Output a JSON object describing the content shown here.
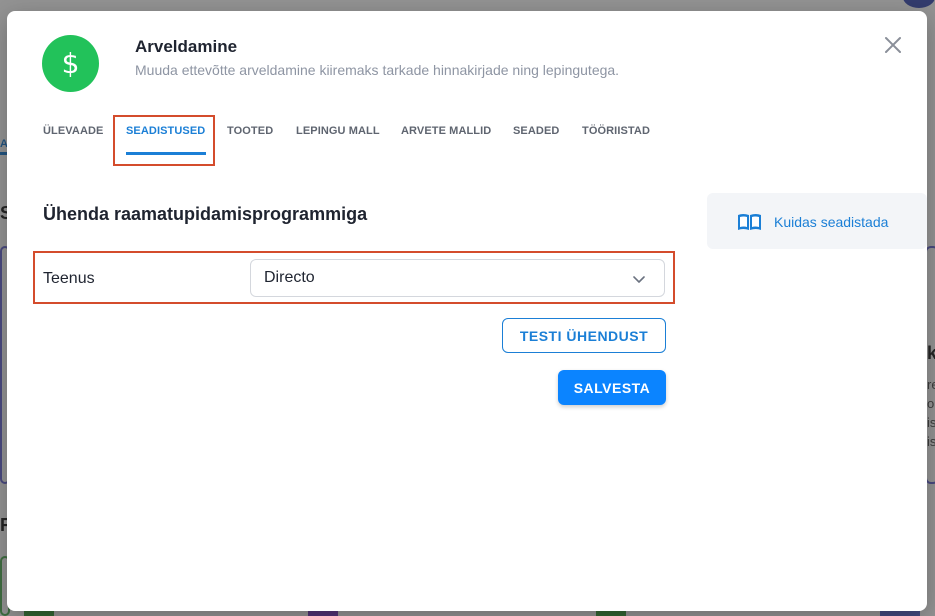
{
  "modal": {
    "title": "Arveldamine",
    "subtitle": "Muuda ettevõtte arveldamine kiiremaks tarkade hinnakirjade ning lepingutega.",
    "icon": "dollar-icon",
    "icon_glyph": "$"
  },
  "tabs": [
    {
      "label": "ÜLEVAADE",
      "active": false
    },
    {
      "label": "SEADISTUSED",
      "active": true
    },
    {
      "label": "TOOTED",
      "active": false
    },
    {
      "label": "LEPINGU MALL",
      "active": false
    },
    {
      "label": "ARVETE MALLID",
      "active": false
    },
    {
      "label": "SEADED",
      "active": false
    },
    {
      "label": "TÖÖRIISTAD",
      "active": false
    }
  ],
  "section": {
    "title": "Ühenda raamatupidamisprogrammiga"
  },
  "form": {
    "service_label": "Teenus",
    "service_value": "Directo",
    "test_button": "TESTI ÜHENDUST",
    "save_button": "SALVESTA"
  },
  "help": {
    "label": "Kuidas seadistada",
    "icon": "book-icon"
  },
  "background": {
    "frag_tab": "A",
    "frag_s": "S",
    "frag_r": "R",
    "frag_right_k": "k",
    "frag_right_lines": [
      "re",
      "o",
      "is",
      "is"
    ]
  },
  "colors": {
    "accent": "#1b7fd6",
    "primary_button": "#0b84ff",
    "app_icon": "#22c25a",
    "highlight": "#d44c2c"
  }
}
